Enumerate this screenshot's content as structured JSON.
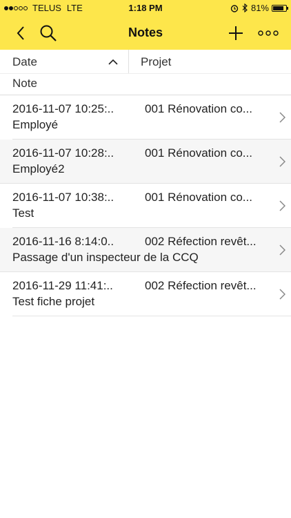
{
  "status": {
    "carrier": "TELUS",
    "network": "LTE",
    "time": "1:18 PM",
    "battery": "81%",
    "battery_level": 0.81
  },
  "nav": {
    "title": "Notes"
  },
  "columns": {
    "date": "Date",
    "projet": "Projet",
    "note": "Note"
  },
  "rows": [
    {
      "date": "2016-11-07 10:25:..",
      "projet": "001 Rénovation co...",
      "note": "Employé"
    },
    {
      "date": "2016-11-07 10:28:..",
      "projet": "001 Rénovation co...",
      "note": "Employé2"
    },
    {
      "date": "2016-11-07 10:38:..",
      "projet": "001 Rénovation co...",
      "note": "Test"
    },
    {
      "date": "2016-11-16 8:14:0..",
      "projet": "002 Réfection revêt...",
      "note": "Passage d'un inspecteur de la CCQ"
    },
    {
      "date": "2016-11-29 11:41:..",
      "projet": "002 Réfection revêt...",
      "note": "Test fiche projet"
    }
  ],
  "colors": {
    "header": "#fde64b",
    "alt_row": "#f6f6f6"
  }
}
